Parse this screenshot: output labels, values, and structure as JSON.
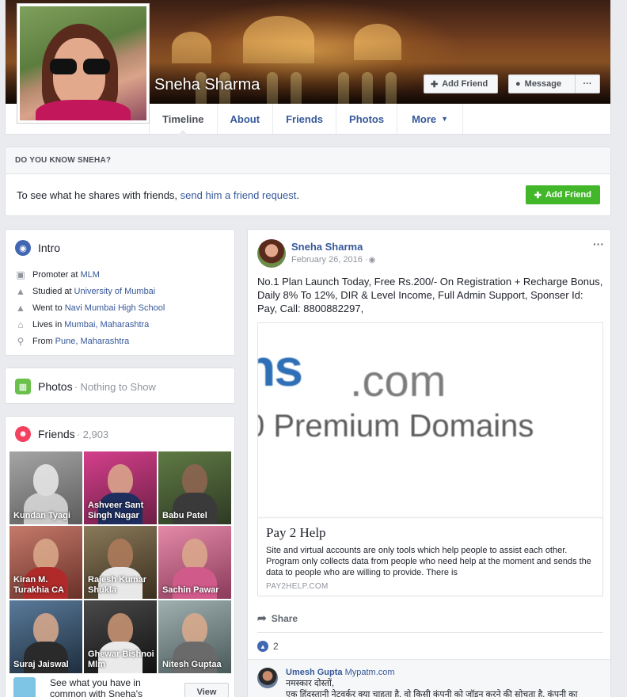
{
  "profile": {
    "name": "Sneha Sharma",
    "add_friend_label": "Add Friend",
    "message_label": "Message",
    "more_dots": "···"
  },
  "tabs": [
    {
      "label": "Timeline"
    },
    {
      "label": "About"
    },
    {
      "label": "Friends"
    },
    {
      "label": "Photos"
    },
    {
      "label": "More"
    }
  ],
  "do_you_know": {
    "heading": "DO YOU KNOW SNEHA?",
    "text_before": "To see what he shares with friends, ",
    "link": "send him a friend request",
    "text_after": ".",
    "button": "Add Friend"
  },
  "intro": {
    "title": "Intro",
    "rows": [
      {
        "icon": "briefcase-icon",
        "prefix": "Promoter at ",
        "link": "MLM"
      },
      {
        "icon": "graduation-cap-icon",
        "prefix": "Studied at ",
        "link": "University of Mumbai"
      },
      {
        "icon": "graduation-cap-icon",
        "prefix": "Went to ",
        "link": "Navi Mumbai High School"
      },
      {
        "icon": "home-icon",
        "prefix": "Lives in ",
        "link": "Mumbai, Maharashtra"
      },
      {
        "icon": "location-pin-icon",
        "prefix": "From ",
        "link": "Pune, Maharashtra"
      }
    ]
  },
  "photos": {
    "title": "Photos",
    "subtitle": " · Nothing to Show"
  },
  "friends": {
    "title": "Friends",
    "count": " · 2,903",
    "items": [
      {
        "name": "Kundan Tyagi",
        "bg": "#7a7a7a"
      },
      {
        "name": "Ashveer Sant Singh Nagar",
        "bg": "#b8306b"
      },
      {
        "name": "Babu Patel",
        "bg": "#4a5a3a"
      },
      {
        "name": "Kiran M. Turakhia CA",
        "bg": "#8a5a4a"
      },
      {
        "name": "Rajesh Kumar Shukla",
        "bg": "#6a5a3a"
      },
      {
        "name": "Sachin Pawar",
        "bg": "#c06080"
      },
      {
        "name": "Suraj Jaiswal",
        "bg": "#3a5a7a"
      },
      {
        "name": "Ghewar Bishnoi Mlm",
        "bg": "#3a3a3a"
      },
      {
        "name": "Nitesh Guptaa",
        "bg": "#7a8a8a"
      }
    ],
    "common_text": "See what you have in common with Sneha's",
    "view_button": "View"
  },
  "post": {
    "author": "Sneha Sharma",
    "date": "February 26, 2016 · ",
    "body": "No.1 Plan Launch Today, Free Rs.200/- On Registration + Recharge Bonus, Daily 8% To 12%, DIR & Level Income, Full Admin Support, Sponser Id: Pay, Call: 8800882297,",
    "link_image_big": "ns",
    "link_image_com": ".com",
    "link_image_premium": "0 Premium Domains",
    "link_title": "Pay 2 Help",
    "link_desc": "Site and virtual accounts are only tools which help people to assist each other. Program only collects data from people who need help at the moment and sends the data to people who are willing to provide. There is",
    "link_domain": "PAY2HELP.COM",
    "share_label": "Share",
    "like_count": "2",
    "comment_author": "Umesh Gupta",
    "comment_page": "Mypatm.com",
    "comment_line1": "नमस्कार दोस्तों,",
    "comment_line2": "एक हिंदुस्तानी नेटवर्कर क्या चाहता है, वो किसी कंपनी को जॉइन करने की सोचता है, कंपनी का"
  }
}
